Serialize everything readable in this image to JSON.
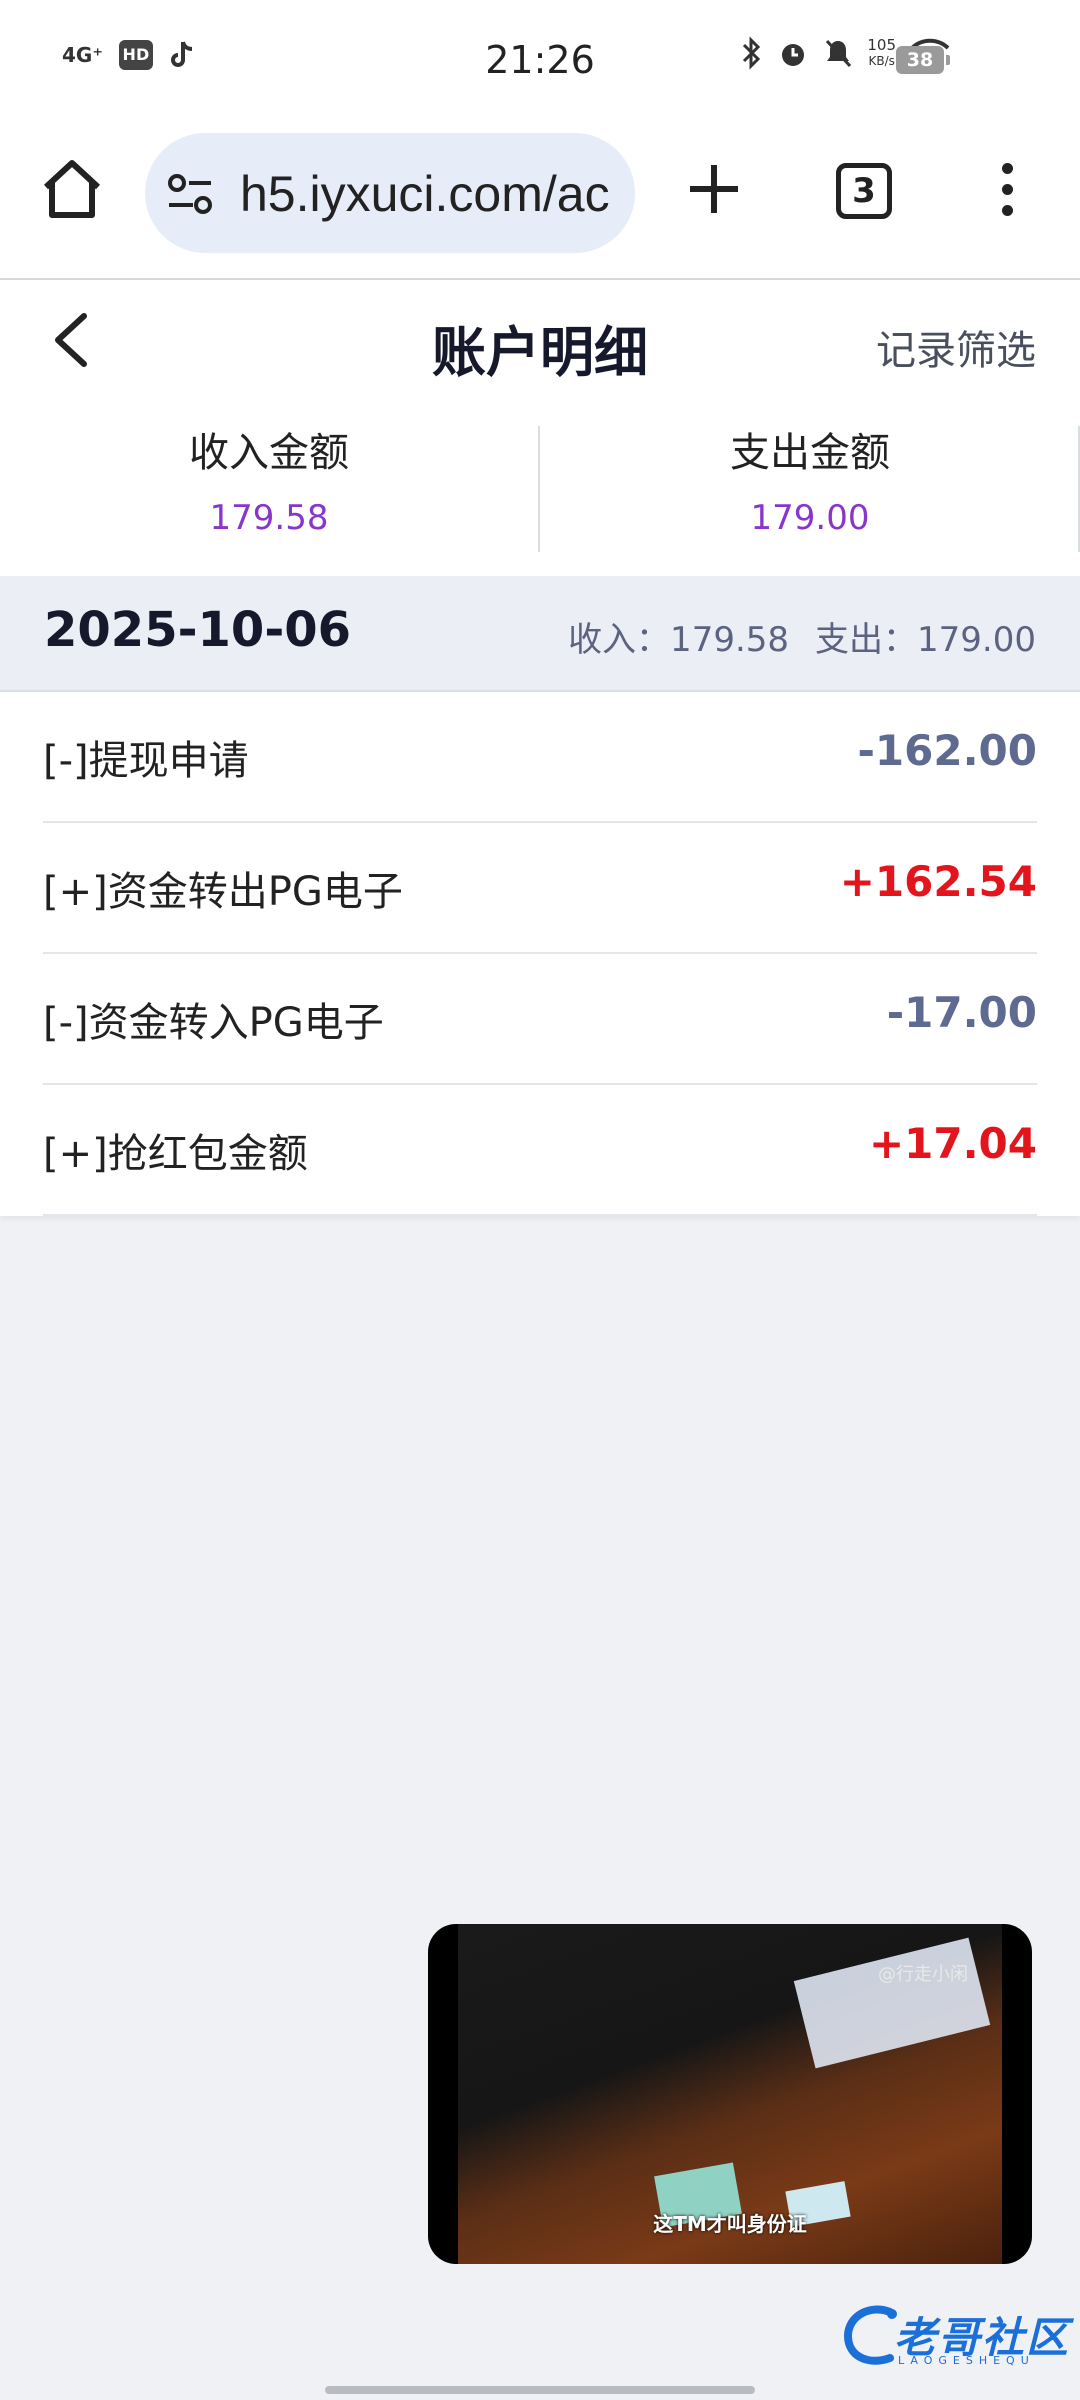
{
  "status_bar": {
    "network": "4G⁺",
    "hd_badge": "HD",
    "time": "21:26",
    "speed_value": "105",
    "speed_unit": "KB/s",
    "battery": "38"
  },
  "browser": {
    "url": "h5.iyxuci.com/ac",
    "tab_count": "3"
  },
  "header": {
    "title": "账户明细",
    "filter_label": "记录筛选"
  },
  "summary": {
    "income_label": "收入金额",
    "income_value": "179.58",
    "expense_label": "支出金额",
    "expense_value": "179.00"
  },
  "day_group": {
    "date": "2025-10-06",
    "income_text": "收入：179.58",
    "expense_text": "支出：179.00"
  },
  "records": [
    {
      "label": "[-]提现申请",
      "amount": "-162.00",
      "type": "neg"
    },
    {
      "label": "[+]资金转出PG电子",
      "amount": "+162.54",
      "type": "pos"
    },
    {
      "label": "[-]资金转入PG电子",
      "amount": "-17.00",
      "type": "neg"
    },
    {
      "label": "[+]抢红包金额",
      "amount": "+17.04",
      "type": "pos"
    }
  ],
  "video": {
    "watermark": "@行走小闲",
    "caption": "这TM才叫身份证"
  },
  "logo": {
    "text": "老哥社区",
    "sub": "LAOGESHEQU"
  },
  "colors": {
    "income_purple": "#8a35c9",
    "positive_red": "#e3141c",
    "negative_slate": "#5f6a90"
  }
}
